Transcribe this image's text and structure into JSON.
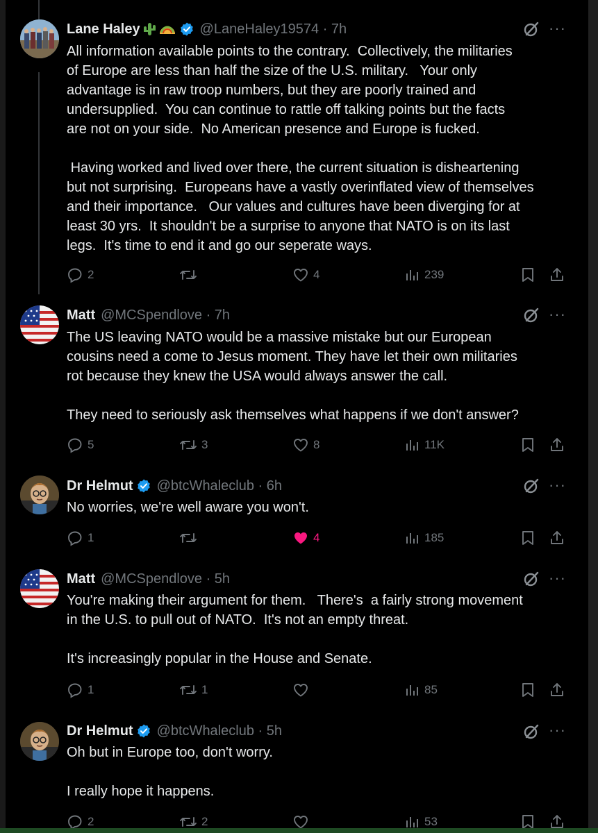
{
  "tweets": [
    {
      "name": "Lane Haley",
      "verified": true,
      "handle": "@LaneHaley19574",
      "time": "7h",
      "handle_time": "@LaneHaley19574 · 7h",
      "text": "All information available points to the contrary.  Collectively, the militaries\nof Europe are less than half the size of the U.S. military.   Your only\nadvantage is in raw troop numbers, but they are poorly trained and\nundersupplied.  You can continue to rattle off talking points but the facts\nare not on your side.  No American presence and Europe is fucked.\n\n Having worked and lived over there, the current situation is disheartening\nbut not surprising.  Europeans have a vastly overinflated view of themselves\nand their importance.   Our values and cultures have been diverging for at\nleast 30 yrs.  It shouldn't be a surprise to anyone that NATO is on its last\nlegs.  It's time to end it and go our seperate ways.",
      "replies": "2",
      "retweets": "",
      "likes": "4",
      "views": "239",
      "liked": false
    },
    {
      "name": "Matt",
      "verified": false,
      "handle": "@MCSpendlove",
      "time": "7h",
      "handle_time": "@MCSpendlove · 7h",
      "text": "The US leaving NATO would be a massive mistake but our European\ncousins need a come to Jesus moment. They have let their own militaries\nrot because they knew the USA would always answer the call.\n\nThey need to seriously ask themselves what happens if we don't answer?",
      "replies": "5",
      "retweets": "3",
      "likes": "8",
      "views": "11K",
      "liked": false
    },
    {
      "name": "Dr Helmut",
      "verified": true,
      "handle": "@btcWhaleclub",
      "time": "6h",
      "handle_time": "@btcWhaleclub · 6h",
      "text": "No worries, we're well aware you won't.",
      "replies": "1",
      "retweets": "",
      "likes": "4",
      "views": "185",
      "liked": true
    },
    {
      "name": "Matt",
      "verified": false,
      "handle": "@MCSpendlove",
      "time": "5h",
      "handle_time": "@MCSpendlove · 5h",
      "text": "You're making their argument for them.   There's  a fairly strong movement\nin the U.S. to pull out of NATO.  It's not an empty threat.\n\nIt's increasingly popular in the House and Senate.",
      "replies": "1",
      "retweets": "1",
      "likes": "",
      "views": "85",
      "liked": false
    },
    {
      "name": "Dr Helmut",
      "verified": true,
      "handle": "@btcWhaleclub",
      "time": "5h",
      "handle_time": "@btcWhaleclub · 5h",
      "text": "Oh but in Europe too, don't worry.\n\nI really hope it happens.",
      "replies": "2",
      "retweets": "2",
      "likes": "",
      "views": "53",
      "liked": false
    }
  ],
  "colors": {
    "background": "#000000",
    "text": "#e7e9ea",
    "muted": "#71767b",
    "verified": "#1d9bf0",
    "like_active": "#f91880"
  },
  "icons": [
    "reply-icon",
    "retweet-icon",
    "like-icon",
    "views-icon",
    "bookmark-icon",
    "share-icon",
    "grok-icon",
    "more-icon",
    "verified-badge-icon",
    "cactus-emoji",
    "taco-emoji"
  ]
}
